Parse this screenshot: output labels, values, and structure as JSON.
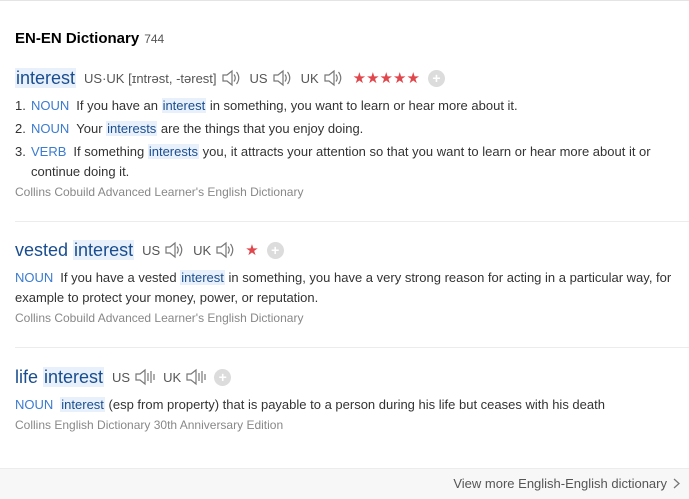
{
  "header": {
    "title": "EN-EN Dictionary",
    "count": "744"
  },
  "entries": [
    {
      "word_pre": "",
      "word_hl": "interest",
      "word_post": "",
      "pron": "US·UK [ɪntrəst, -tərest]",
      "us_label": "US",
      "uk_label": "UK",
      "stars": "★★★★★",
      "senses": [
        {
          "num": "1.",
          "pos": "NOUN",
          "pre": "If you have an ",
          "hl": "interest",
          "post": " in something, you want to learn or hear more about it."
        },
        {
          "num": "2.",
          "pos": "NOUN",
          "pre": "Your ",
          "hl": "interests",
          "post": " are the things that you enjoy doing."
        },
        {
          "num": "3.",
          "pos": "VERB",
          "pre": "If something ",
          "hl": "interests",
          "post": " you, it attracts your attention so that you want to learn or hear more about it or continue doing it."
        }
      ],
      "source": "Collins Cobuild Advanced Learner's English Dictionary"
    },
    {
      "word_pre": "vested ",
      "word_hl": "interest",
      "us_label": "US",
      "uk_label": "UK",
      "stars": "★",
      "sense": {
        "pos": "NOUN",
        "pre": "If you have a vested ",
        "hl": "interest",
        "post": " in something, you have a very strong reason for acting in a particular way, for example to protect your money, power, or reputation."
      },
      "source": "Collins Cobuild Advanced Learner's English Dictionary"
    },
    {
      "word_pre": "life ",
      "word_hl": "interest",
      "us_label": "US",
      "uk_label": "UK",
      "sense": {
        "pos": "NOUN",
        "pre": "",
        "hl": "interest",
        "post": " (esp from property) that is payable to a person during his life but ceases with his death"
      },
      "source": "Collins English Dictionary 30th Anniversary Edition"
    }
  ],
  "footer": {
    "view_more": "View more English-English dictionary"
  },
  "colors": {
    "accent": "#3b7bd0",
    "headword": "#1a4d8f",
    "highlight": "#e8f1fb",
    "star": "#e0474c"
  },
  "icons": {
    "audio": "speaker-icon",
    "audio_muted": "speaker-wave-icon",
    "add": "plus-circle-icon",
    "more": "chevron-right-icon"
  }
}
